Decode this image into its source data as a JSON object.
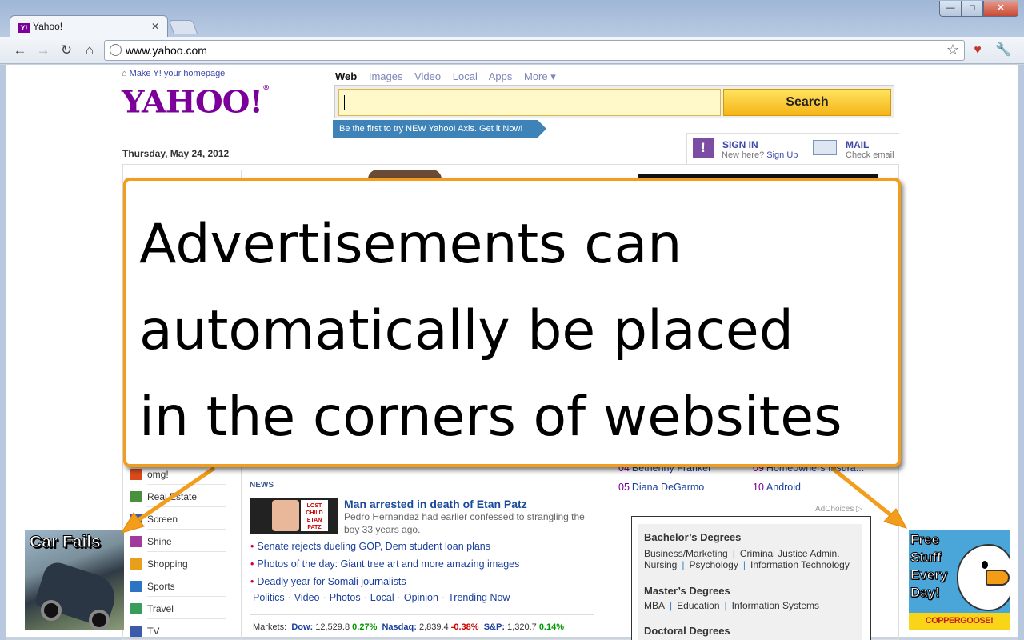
{
  "browser": {
    "tab_title": "Yahoo!",
    "tab_favicon": "Y!",
    "tab_close": "✕",
    "url": "www.yahoo.com",
    "window_controls": {
      "minimize": "—",
      "maximize": "□",
      "close": "✕"
    },
    "icons": [
      "back-icon",
      "forward-icon",
      "reload-icon",
      "home-icon",
      "bookmark-star-icon",
      "extension-icon",
      "wrench-icon"
    ]
  },
  "yahoo": {
    "make_homepage": "Make Y! your homepage",
    "logo": "YAHOO!",
    "logo_mark": "®",
    "search_tabs": [
      {
        "label": "Web",
        "selected": true
      },
      {
        "label": "Images"
      },
      {
        "label": "Video"
      },
      {
        "label": "Local"
      },
      {
        "label": "Apps"
      },
      {
        "label": "More ▾"
      }
    ],
    "search_button": "Search",
    "promo": "Be the first to try NEW Yahoo! Axis.  Get it Now!",
    "date": "Thursday, May 24, 2012",
    "sign_in": {
      "title": "SIGN IN",
      "sub": "New here?",
      "signup": "Sign Up"
    },
    "mail": {
      "title": "MAIL",
      "sub": "Check email"
    },
    "nav_items": [
      {
        "label": "omg!",
        "color": "#d84a1b"
      },
      {
        "label": "Real Estate",
        "color": "#4a8f3c"
      },
      {
        "label": "Screen",
        "color": "#3b5aa8"
      },
      {
        "label": "Shine",
        "color": "#a03a9c"
      },
      {
        "label": "Shopping",
        "color": "#e8a01a"
      },
      {
        "label": "Sports",
        "color": "#2d73c4"
      },
      {
        "label": "Travel",
        "color": "#3a9c5a"
      },
      {
        "label": "TV",
        "color": "#3b5aa8"
      }
    ],
    "news": {
      "heading": "NEWS",
      "thumb_poster": "LOST CHILD ETAN PATZ",
      "headline": "Man arrested in death of Etan Patz",
      "summary": "Pedro Hernandez had earlier confessed to strangling the boy 33 years ago.",
      "bullets": [
        "Senate rejects dueling GOP, Dem student loan plans",
        "Photos of the day: Giant tree art and more amazing images",
        "Deadly year for Somali journalists"
      ],
      "categories": [
        "Politics",
        "Video",
        "Photos",
        "Local",
        "Opinion",
        "Trending Now"
      ],
      "markets": {
        "label": "Markets:",
        "dow": {
          "name": "Dow:",
          "value": "12,529.8",
          "change": "0.27%"
        },
        "nasdaq": {
          "name": "Nasdaq:",
          "value": "2,839.4",
          "change": "-0.38%"
        },
        "sp": {
          "name": "S&P:",
          "value": "1,320.7",
          "change": "0.14%"
        }
      }
    },
    "trending": [
      {
        "num": "04",
        "label": "Bethenny Frankel"
      },
      {
        "num": "09",
        "label": "Homeowners Insura..."
      },
      {
        "num": "05",
        "label": "Diana DeGarmo"
      },
      {
        "num": "10",
        "label": "Android"
      }
    ],
    "adchoices": "AdChoices",
    "degrees_ad": {
      "bachelors": "Bachelor’s Degrees",
      "bachelors_items": [
        "Business/Marketing",
        "Criminal Justice Admin.",
        "Nursing",
        "Psychology",
        "Information Technology"
      ],
      "masters": "Master’s Degrees",
      "masters_items": [
        "MBA",
        "Education",
        "Information Systems"
      ],
      "doctoral": "Doctoral Degrees"
    }
  },
  "ads": {
    "car_fails": "Car Fails",
    "free_stuff": "Free Stuff Every Day!",
    "free_brand": "COPPERGOOSE!"
  },
  "callout": {
    "line1": "Advertisements can",
    "line2": "automatically be placed",
    "line3": "in the corners of websites"
  },
  "colors": {
    "yahoo_purple": "#7b0099",
    "callout_border": "#f39d1c",
    "search_yellow": "#ffe35f"
  }
}
